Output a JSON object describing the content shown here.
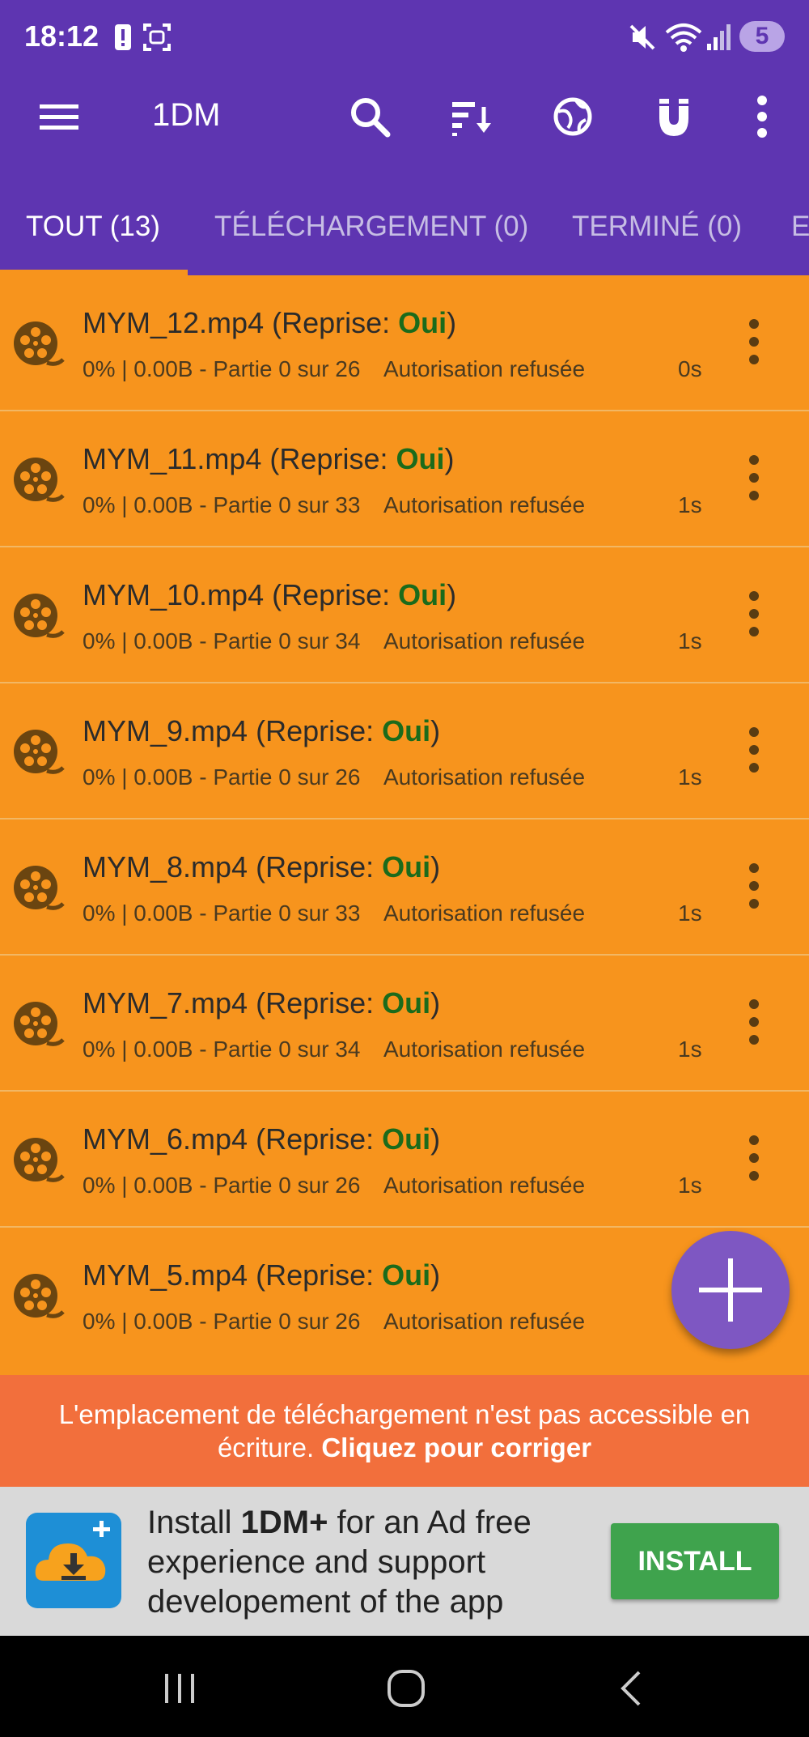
{
  "status_bar": {
    "time": "18:12",
    "notification_badge": "5",
    "icons": [
      "alert-icon",
      "screenshot-icon",
      "mute-icon",
      "wifi-icon",
      "signal-icon"
    ]
  },
  "toolbar": {
    "title": "1DM",
    "icons": [
      "menu-icon",
      "search-icon",
      "sort-icon",
      "globe-icon",
      "magnet-icon",
      "more-vert-icon"
    ]
  },
  "tabs": [
    {
      "label": "TOUT (13)",
      "active": true
    },
    {
      "label": "TÉLÉCHARGEMENT (0)",
      "active": false
    },
    {
      "label": "TERMINÉ (0)",
      "active": false
    },
    {
      "label": "E",
      "active": false
    }
  ],
  "downloads": [
    {
      "name": "MYM_12.mp4",
      "resume_prefix": " (Reprise: ",
      "resume_value": "Oui",
      "resume_suffix": ")",
      "progress": "0% | 0.00B - Partie 0 sur 26",
      "status": "Autorisation refusée",
      "time": "0s"
    },
    {
      "name": "MYM_11.mp4",
      "resume_prefix": " (Reprise: ",
      "resume_value": "Oui",
      "resume_suffix": ")",
      "progress": "0% | 0.00B - Partie 0 sur 33",
      "status": "Autorisation refusée",
      "time": "1s"
    },
    {
      "name": "MYM_10.mp4",
      "resume_prefix": " (Reprise: ",
      "resume_value": "Oui",
      "resume_suffix": ")",
      "progress": "0% | 0.00B - Partie 0 sur 34",
      "status": "Autorisation refusée",
      "time": "1s"
    },
    {
      "name": "MYM_9.mp4",
      "resume_prefix": " (Reprise: ",
      "resume_value": "Oui",
      "resume_suffix": ")",
      "progress": "0% | 0.00B - Partie 0 sur 26",
      "status": "Autorisation refusée",
      "time": "1s"
    },
    {
      "name": "MYM_8.mp4",
      "resume_prefix": " (Reprise: ",
      "resume_value": "Oui",
      "resume_suffix": ")",
      "progress": "0% | 0.00B - Partie 0 sur 33",
      "status": "Autorisation refusée",
      "time": "1s"
    },
    {
      "name": "MYM_7.mp4",
      "resume_prefix": " (Reprise: ",
      "resume_value": "Oui",
      "resume_suffix": ")",
      "progress": "0% | 0.00B - Partie 0 sur 34",
      "status": "Autorisation refusée",
      "time": "1s"
    },
    {
      "name": "MYM_6.mp4",
      "resume_prefix": " (Reprise: ",
      "resume_value": "Oui",
      "resume_suffix": ")",
      "progress": "0% | 0.00B - Partie 0 sur 26",
      "status": "Autorisation refusée",
      "time": "1s"
    },
    {
      "name": "MYM_5.mp4",
      "resume_prefix": " (Reprise: ",
      "resume_value": "Oui",
      "resume_suffix": ")",
      "progress": "0% | 0.00B - Partie 0 sur 26",
      "status": "Autorisation refusée",
      "time": ""
    }
  ],
  "warning": {
    "text": "L'emplacement de téléchargement n'est pas accessible en écriture. ",
    "fix_label": "Cliquez pour corriger"
  },
  "ad": {
    "text_before": "Install ",
    "text_bold": "1DM+",
    "text_after": " for an Ad free experience and support developement of the app",
    "install_label": "INSTALL"
  },
  "colors": {
    "primary": "#5e35b1",
    "list_background": "#f7941d",
    "resume_yes": "#1b6b1b",
    "warning": "#f26f3c",
    "install_button": "#3fa34d",
    "fab": "#7e57c2"
  }
}
